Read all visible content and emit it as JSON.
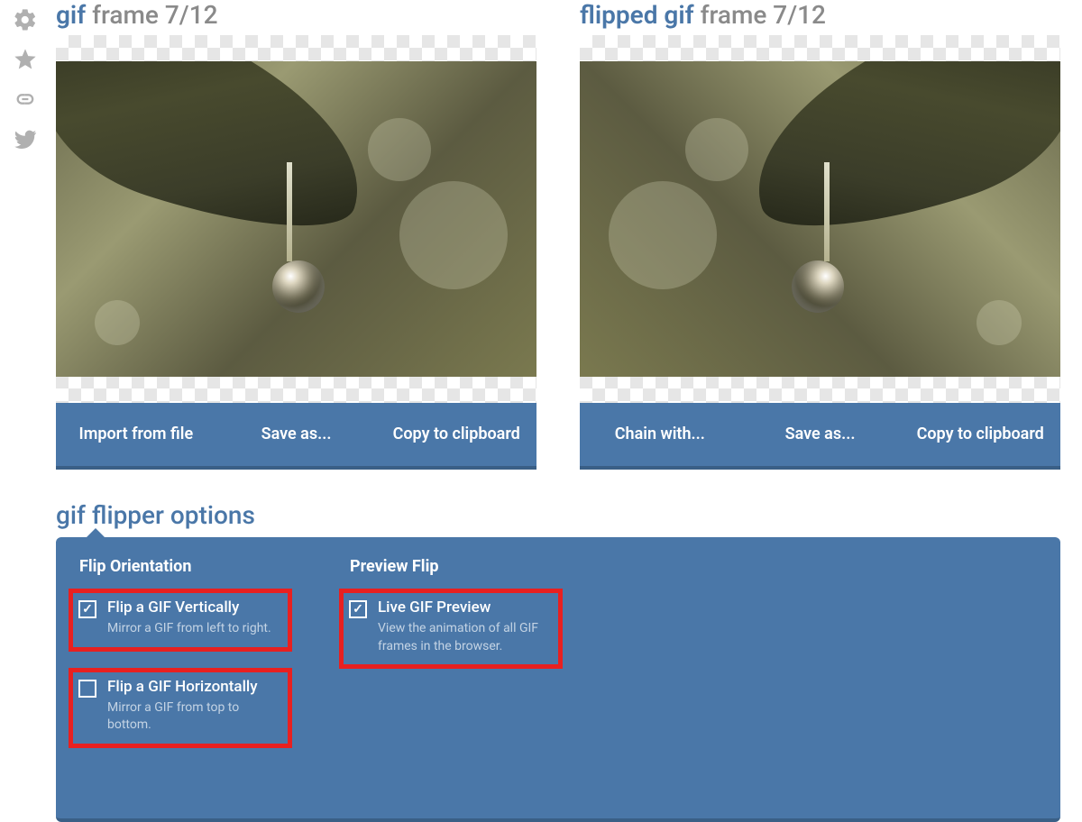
{
  "sidebar": {
    "icons": [
      "gear-icon",
      "star-icon",
      "link-icon",
      "twitter-icon"
    ]
  },
  "panels": {
    "left": {
      "title_accent": "gif",
      "title_rest": "frame 7/12",
      "actions": [
        "Import from file",
        "Save as...",
        "Copy to clipboard"
      ]
    },
    "right": {
      "title_accent": "flipped gif",
      "title_rest": "frame 7/12",
      "actions": [
        "Chain with...",
        "Save as...",
        "Copy to clipboard"
      ]
    }
  },
  "options": {
    "title": "gif flipper options",
    "columns": [
      {
        "heading": "Flip Orientation",
        "items": [
          {
            "label": "Flip a GIF Vertically",
            "desc": "Mirror a GIF from left to right.",
            "checked": true,
            "highlight": true
          },
          {
            "label": "Flip a GIF Horizontally",
            "desc": "Mirror a GIF from top to bottom.",
            "checked": false,
            "highlight": true
          }
        ]
      },
      {
        "heading": "Preview Flip",
        "items": [
          {
            "label": "Live GIF Preview",
            "desc": "View the animation of all GIF frames in the browser.",
            "checked": true,
            "highlight": true
          }
        ]
      }
    ]
  }
}
